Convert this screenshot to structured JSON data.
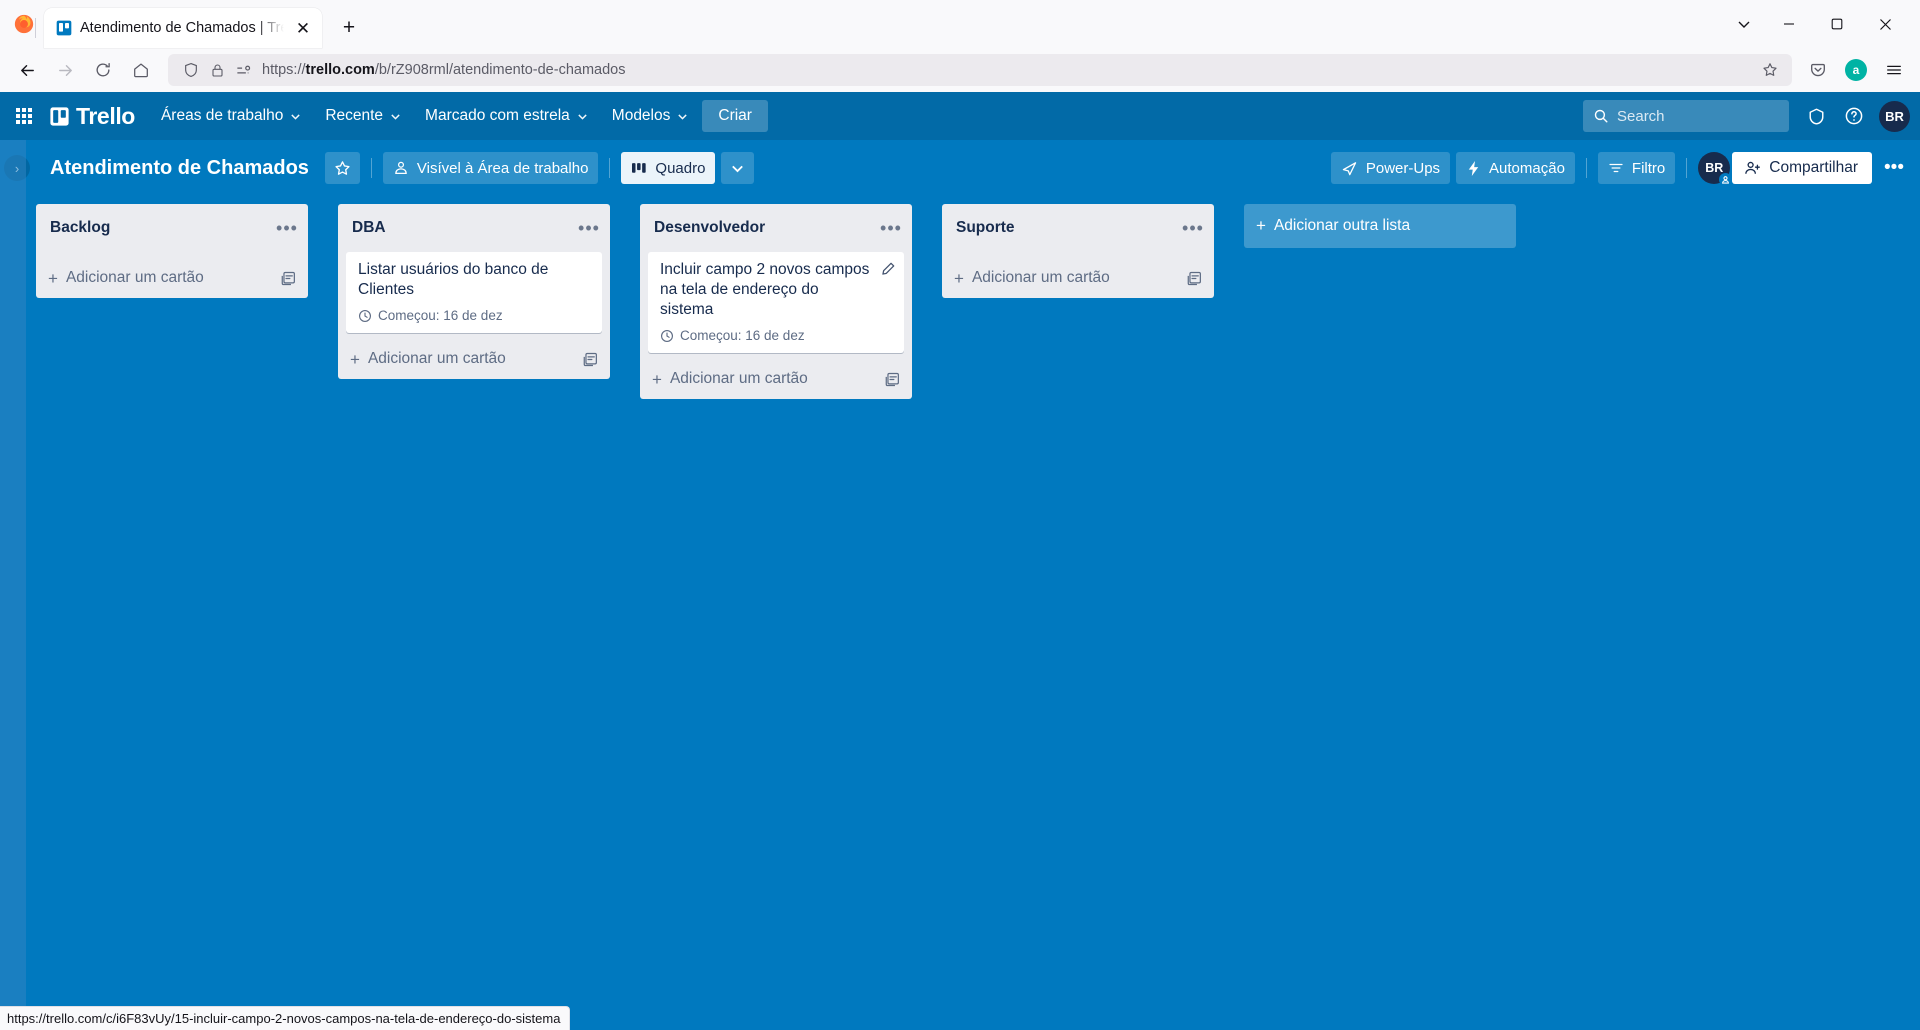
{
  "browser": {
    "tab": {
      "title": "Atendimento de Chamados | Trello",
      "favicon_name": "trello-favicon",
      "close_label": "✕",
      "new_tab_label": "+"
    },
    "window_controls": {
      "list_all_tabs": "⌄",
      "minimize": "—",
      "maximize": "❐",
      "close": "✕"
    },
    "url": {
      "scheme_host": "https://trello.com",
      "host_bold": "trello.com",
      "prefix": "https://",
      "path": "/b/rZ908rml/atendimento-de-chamados",
      "full": "https://trello.com/b/rZ908rml/atendimento-de-chamados"
    },
    "icons": {
      "back": "back-arrow-icon",
      "forward": "forward-arrow-icon",
      "reload": "reload-icon",
      "home": "home-icon",
      "shield": "shield-icon",
      "lock": "lock-icon",
      "permissions": "permissions-icon",
      "bookmark_star": "star-outline-icon",
      "save_to_pocket": "pocket-icon",
      "app_menu": "hamburger-menu-icon"
    },
    "account_avatar": "a",
    "statusbar_url": "https://trello.com/c/i6F83vUy/15-incluir-campo-2-novos-campos-na-tela-de-endereço-do-sistema"
  },
  "topnav": {
    "apps_label": "app-switcher",
    "brand": "Trello",
    "items": [
      {
        "label": "Áreas de trabalho",
        "has_chevron": true
      },
      {
        "label": "Recente",
        "has_chevron": true
      },
      {
        "label": "Marcado com estrela",
        "has_chevron": true
      },
      {
        "label": "Modelos",
        "has_chevron": true
      }
    ],
    "create_label": "Criar",
    "search_placeholder": "Search",
    "info_icon": "info-icon",
    "help_icon": "help-circle-icon",
    "user_initials": "BR"
  },
  "board_header": {
    "sidebar_toggle": "›",
    "title": "Atendimento de Chamados",
    "star_icon": "star-outline-icon",
    "visibility_label": "Visível à Área de trabalho",
    "visibility_icon": "workspace-icon",
    "view_label": "Quadro",
    "view_icon": "board-view-icon",
    "view_chevron": "⌄",
    "powerups_label": "Power-Ups",
    "automation_label": "Automação",
    "filter_label": "Filtro",
    "member_initials": "BR",
    "share_label": "Compartilhar",
    "menu_dots": "•••"
  },
  "board": {
    "add_card_label": "Adicionar um cartão",
    "add_list_label": "Adicionar outra lista",
    "list_menu_dots": "•••",
    "lists": [
      {
        "title": "Backlog",
        "cards": []
      },
      {
        "title": "DBA",
        "cards": [
          {
            "title": "Listar usuários do banco de Clientes",
            "badge": "Começou: 16 de dez",
            "has_edit_pencil": false
          }
        ]
      },
      {
        "title": "Desenvolvedor",
        "cards": [
          {
            "title": "Incluir campo 2 novos campos na tela de endereço do sistema",
            "badge": "Começou: 16 de dez",
            "has_edit_pencil": true
          }
        ]
      },
      {
        "title": "Suporte",
        "cards": []
      }
    ]
  },
  "colors": {
    "trello_nav": "#026AA7",
    "board_bg": "#0079BF",
    "list_bg": "#EBECF0",
    "card_bg": "#FFFFFF",
    "text_dark": "#172B4D",
    "text_muted": "#5E6C84"
  }
}
